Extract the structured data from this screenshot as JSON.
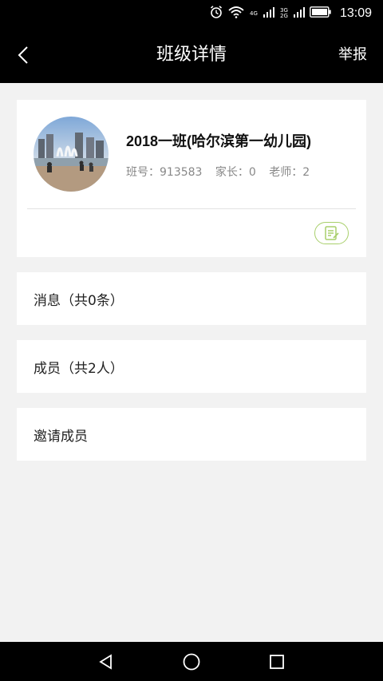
{
  "status_bar": {
    "time": "13:09",
    "network_top": "4G",
    "network_mid_top": "3G",
    "network_mid_bottom": "2G",
    "icons": [
      "alarm-icon",
      "wifi-icon",
      "signal-icon",
      "battery-icon"
    ]
  },
  "nav": {
    "title": "班级详情",
    "report_label": "举报",
    "back_icon": "back-chevron-icon"
  },
  "class_card": {
    "name": "2018一班(哈尔滨第一幼儿园)",
    "class_number": "班号：913583",
    "parents": "家长：0",
    "teachers": "老师：2",
    "edit_icon": "edit-note-icon",
    "accent_color": "#a8cf6b"
  },
  "rows": {
    "messages": "消息（共0条）",
    "members": "成员（共2人）",
    "invite": "邀请成员"
  },
  "system_nav": {
    "icons": [
      "back-triangle-icon",
      "home-circle-icon",
      "recents-square-icon"
    ]
  }
}
